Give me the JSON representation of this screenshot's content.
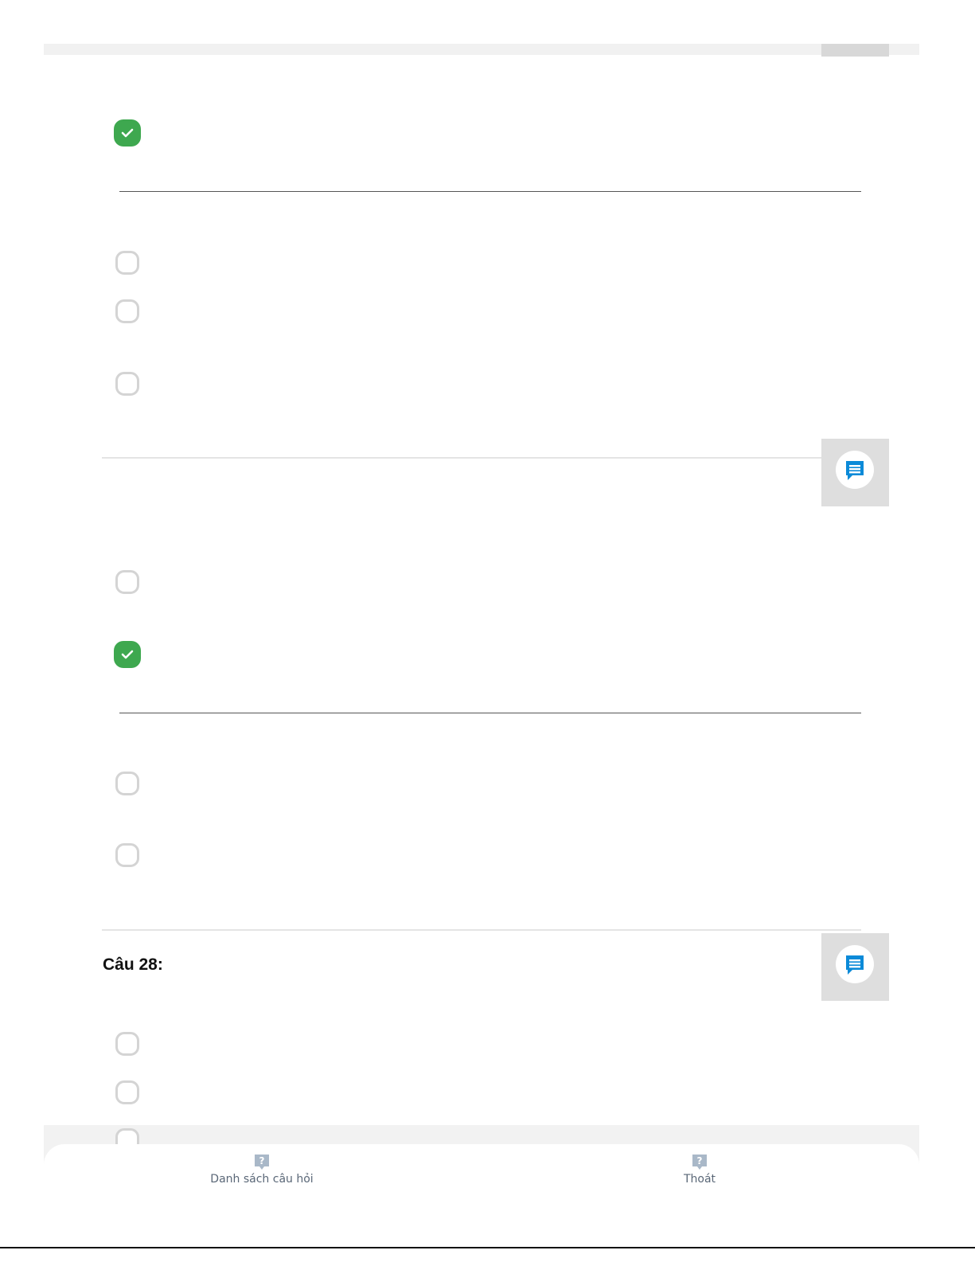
{
  "question": {
    "title": "Câu 28:"
  },
  "bottom_nav": {
    "question_list_label": "Danh sách câu hỏi",
    "exit_label": "Thoát"
  },
  "icons": {
    "check": "check-icon",
    "comment": "comment-icon",
    "help": "question-mark-icon"
  },
  "colors": {
    "checked": "#3ea84f",
    "comment_icon": "#0b8ad8",
    "nav_icon": "#a9b8c8"
  }
}
